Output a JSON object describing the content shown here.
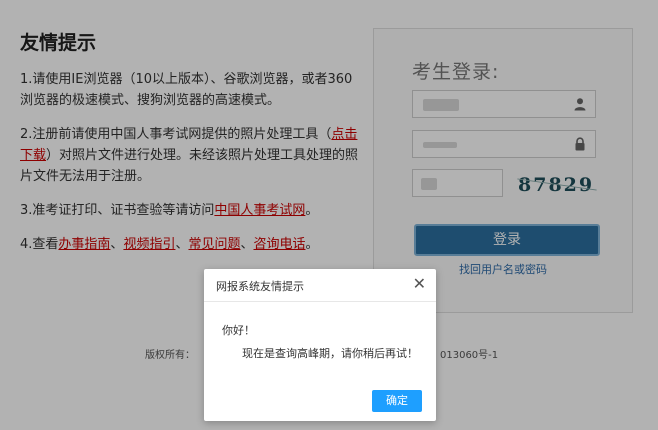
{
  "notice": {
    "title": "友情提示",
    "item1": "1.请使用IE浏览器（10以上版本）、谷歌浏览器，或者360浏览器的极速模式、搜狗浏览器的高速模式。",
    "item2_prefix": "2.注册前请使用中国人事考试网提供的照片处理工具（",
    "item2_link": "点击下载",
    "item2_suffix": "）对照片文件进行处理。未经该照片处理工具处理的照片文件无法用于注册。",
    "item3_prefix": "3.准考证打印、证书查验等请访问",
    "item3_link": "中国人事考试网",
    "item3_suffix": "。",
    "item4_prefix": "4.查看",
    "item4_links": [
      "办事指南",
      "视频指引",
      "常见问题",
      "咨询电话"
    ],
    "item4_sep": "、",
    "item4_suffix": "。"
  },
  "login": {
    "title": "考生登录:",
    "button_label": "登录",
    "forgot_label": "找回用户名或密码",
    "captcha_text": "87829"
  },
  "icons": {
    "username": "user-icon",
    "password": "lock-icon",
    "close": "close-icon"
  },
  "footer": {
    "left": "版权所有：",
    "right": "013060号-1"
  },
  "dialog": {
    "title": "网报系统友情提示",
    "close_glyph": "✕",
    "greeting": "你好！",
    "message": "现在是查询高峰期，请你稍后再试！",
    "ok_label": "确定"
  },
  "colors": {
    "link_red": "#cc0000",
    "login_button": "#2c6f9f",
    "ok_button": "#1e9fff"
  }
}
